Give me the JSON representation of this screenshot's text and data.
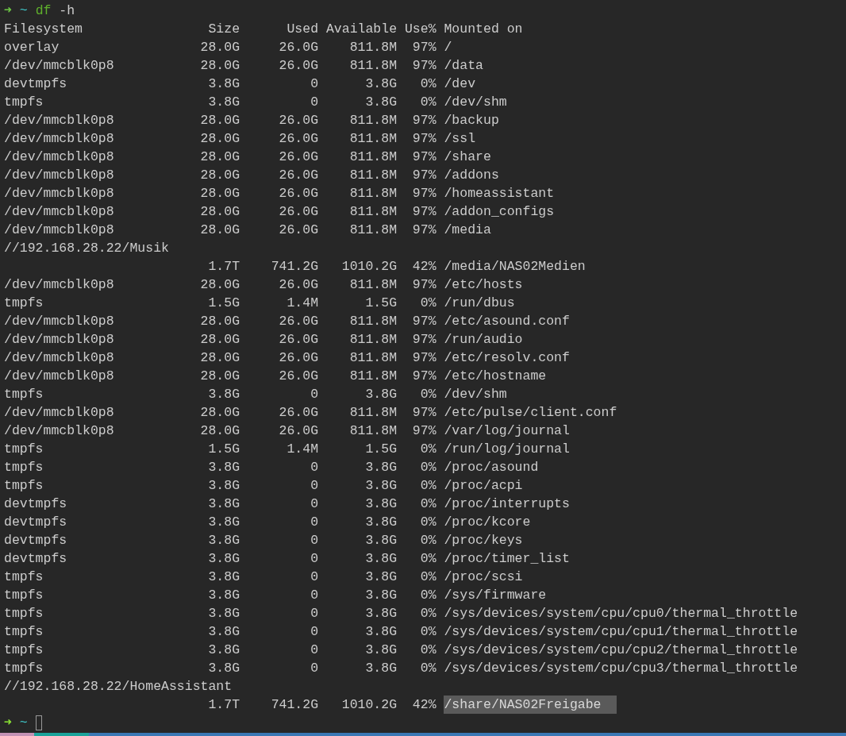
{
  "prompt": {
    "arrow": "➜",
    "dir": "~",
    "command": "df",
    "args": "-h"
  },
  "header": {
    "filesystem": "Filesystem",
    "size": "Size",
    "used": "Used",
    "available": "Available",
    "use": "Use%",
    "mounted": "Mounted on"
  },
  "rows": [
    {
      "filesystem": "overlay",
      "size": "28.0G",
      "used": "26.0G",
      "available": "811.8M",
      "use": "97%",
      "mounted": "/",
      "selected": false
    },
    {
      "filesystem": "/dev/mmcblk0p8",
      "size": "28.0G",
      "used": "26.0G",
      "available": "811.8M",
      "use": "97%",
      "mounted": "/data",
      "selected": false
    },
    {
      "filesystem": "devtmpfs",
      "size": "3.8G",
      "used": "0",
      "available": "3.8G",
      "use": "0%",
      "mounted": "/dev",
      "selected": false
    },
    {
      "filesystem": "tmpfs",
      "size": "3.8G",
      "used": "0",
      "available": "3.8G",
      "use": "0%",
      "mounted": "/dev/shm",
      "selected": false
    },
    {
      "filesystem": "/dev/mmcblk0p8",
      "size": "28.0G",
      "used": "26.0G",
      "available": "811.8M",
      "use": "97%",
      "mounted": "/backup",
      "selected": false
    },
    {
      "filesystem": "/dev/mmcblk0p8",
      "size": "28.0G",
      "used": "26.0G",
      "available": "811.8M",
      "use": "97%",
      "mounted": "/ssl",
      "selected": false
    },
    {
      "filesystem": "/dev/mmcblk0p8",
      "size": "28.0G",
      "used": "26.0G",
      "available": "811.8M",
      "use": "97%",
      "mounted": "/share",
      "selected": false
    },
    {
      "filesystem": "/dev/mmcblk0p8",
      "size": "28.0G",
      "used": "26.0G",
      "available": "811.8M",
      "use": "97%",
      "mounted": "/addons",
      "selected": false
    },
    {
      "filesystem": "/dev/mmcblk0p8",
      "size": "28.0G",
      "used": "26.0G",
      "available": "811.8M",
      "use": "97%",
      "mounted": "/homeassistant",
      "selected": false
    },
    {
      "filesystem": "/dev/mmcblk0p8",
      "size": "28.0G",
      "used": "26.0G",
      "available": "811.8M",
      "use": "97%",
      "mounted": "/addon_configs",
      "selected": false
    },
    {
      "filesystem": "/dev/mmcblk0p8",
      "size": "28.0G",
      "used": "26.0G",
      "available": "811.8M",
      "use": "97%",
      "mounted": "/media",
      "selected": false
    },
    {
      "filesystem": "//192.168.28.22/Musik",
      "size": "1.7T",
      "used": "741.2G",
      "available": "1010.2G",
      "use": "42%",
      "mounted": "/media/NAS02Medien",
      "selected": false
    },
    {
      "filesystem": "/dev/mmcblk0p8",
      "size": "28.0G",
      "used": "26.0G",
      "available": "811.8M",
      "use": "97%",
      "mounted": "/etc/hosts",
      "selected": false
    },
    {
      "filesystem": "tmpfs",
      "size": "1.5G",
      "used": "1.4M",
      "available": "1.5G",
      "use": "0%",
      "mounted": "/run/dbus",
      "selected": false
    },
    {
      "filesystem": "/dev/mmcblk0p8",
      "size": "28.0G",
      "used": "26.0G",
      "available": "811.8M",
      "use": "97%",
      "mounted": "/etc/asound.conf",
      "selected": false
    },
    {
      "filesystem": "/dev/mmcblk0p8",
      "size": "28.0G",
      "used": "26.0G",
      "available": "811.8M",
      "use": "97%",
      "mounted": "/run/audio",
      "selected": false
    },
    {
      "filesystem": "/dev/mmcblk0p8",
      "size": "28.0G",
      "used": "26.0G",
      "available": "811.8M",
      "use": "97%",
      "mounted": "/etc/resolv.conf",
      "selected": false
    },
    {
      "filesystem": "/dev/mmcblk0p8",
      "size": "28.0G",
      "used": "26.0G",
      "available": "811.8M",
      "use": "97%",
      "mounted": "/etc/hostname",
      "selected": false
    },
    {
      "filesystem": "tmpfs",
      "size": "3.8G",
      "used": "0",
      "available": "3.8G",
      "use": "0%",
      "mounted": "/dev/shm",
      "selected": false
    },
    {
      "filesystem": "/dev/mmcblk0p8",
      "size": "28.0G",
      "used": "26.0G",
      "available": "811.8M",
      "use": "97%",
      "mounted": "/etc/pulse/client.conf",
      "selected": false
    },
    {
      "filesystem": "/dev/mmcblk0p8",
      "size": "28.0G",
      "used": "26.0G",
      "available": "811.8M",
      "use": "97%",
      "mounted": "/var/log/journal",
      "selected": false
    },
    {
      "filesystem": "tmpfs",
      "size": "1.5G",
      "used": "1.4M",
      "available": "1.5G",
      "use": "0%",
      "mounted": "/run/log/journal",
      "selected": false
    },
    {
      "filesystem": "tmpfs",
      "size": "3.8G",
      "used": "0",
      "available": "3.8G",
      "use": "0%",
      "mounted": "/proc/asound",
      "selected": false
    },
    {
      "filesystem": "tmpfs",
      "size": "3.8G",
      "used": "0",
      "available": "3.8G",
      "use": "0%",
      "mounted": "/proc/acpi",
      "selected": false
    },
    {
      "filesystem": "devtmpfs",
      "size": "3.8G",
      "used": "0",
      "available": "3.8G",
      "use": "0%",
      "mounted": "/proc/interrupts",
      "selected": false
    },
    {
      "filesystem": "devtmpfs",
      "size": "3.8G",
      "used": "0",
      "available": "3.8G",
      "use": "0%",
      "mounted": "/proc/kcore",
      "selected": false
    },
    {
      "filesystem": "devtmpfs",
      "size": "3.8G",
      "used": "0",
      "available": "3.8G",
      "use": "0%",
      "mounted": "/proc/keys",
      "selected": false
    },
    {
      "filesystem": "devtmpfs",
      "size": "3.8G",
      "used": "0",
      "available": "3.8G",
      "use": "0%",
      "mounted": "/proc/timer_list",
      "selected": false
    },
    {
      "filesystem": "tmpfs",
      "size": "3.8G",
      "used": "0",
      "available": "3.8G",
      "use": "0%",
      "mounted": "/proc/scsi",
      "selected": false
    },
    {
      "filesystem": "tmpfs",
      "size": "3.8G",
      "used": "0",
      "available": "3.8G",
      "use": "0%",
      "mounted": "/sys/firmware",
      "selected": false
    },
    {
      "filesystem": "tmpfs",
      "size": "3.8G",
      "used": "0",
      "available": "3.8G",
      "use": "0%",
      "mounted": "/sys/devices/system/cpu/cpu0/thermal_throttle",
      "selected": false
    },
    {
      "filesystem": "tmpfs",
      "size": "3.8G",
      "used": "0",
      "available": "3.8G",
      "use": "0%",
      "mounted": "/sys/devices/system/cpu/cpu1/thermal_throttle",
      "selected": false
    },
    {
      "filesystem": "tmpfs",
      "size": "3.8G",
      "used": "0",
      "available": "3.8G",
      "use": "0%",
      "mounted": "/sys/devices/system/cpu/cpu2/thermal_throttle",
      "selected": false
    },
    {
      "filesystem": "tmpfs",
      "size": "3.8G",
      "used": "0",
      "available": "3.8G",
      "use": "0%",
      "mounted": "/sys/devices/system/cpu/cpu3/thermal_throttle",
      "selected": false
    },
    {
      "filesystem": "//192.168.28.22/HomeAssistant",
      "size": "1.7T",
      "used": "741.2G",
      "available": "1010.2G",
      "use": "42%",
      "mounted": "/share/NAS02Freigabe",
      "selected": true
    }
  ],
  "next_prompt": {
    "arrow": "➜",
    "dir": "~"
  }
}
